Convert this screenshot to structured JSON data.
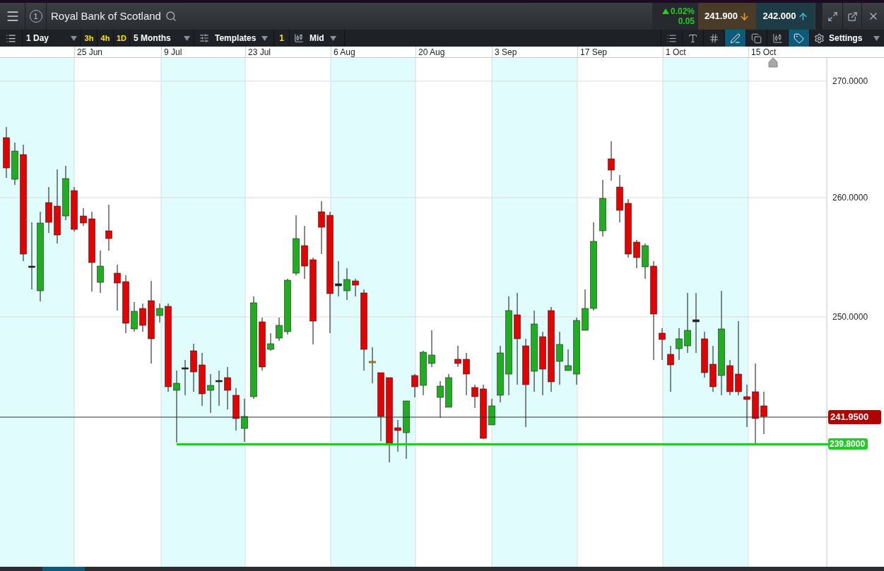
{
  "window": {
    "badge": "1",
    "title": "Royal Bank of Scotland"
  },
  "quote": {
    "change_percent": "0.02%",
    "change": "0.05",
    "sell": "241.900",
    "buy": "242.000"
  },
  "toolbar": {
    "interval": "1 Day",
    "quick_intervals": [
      {
        "label": "3h",
        "selected": false
      },
      {
        "label": "4h",
        "selected": false
      },
      {
        "label": "1D",
        "selected": false
      }
    ],
    "range": "5 Months",
    "templates": "Templates",
    "count": "1",
    "price_type": "Mid",
    "tools": [
      {
        "kind": "axis",
        "selected": false
      },
      {
        "kind": "text",
        "selected": false
      },
      {
        "kind": "grid",
        "selected": false
      },
      {
        "kind": "draw",
        "selected": true
      },
      {
        "kind": "layers",
        "selected": false
      },
      {
        "kind": "candle",
        "selected": false
      },
      {
        "kind": "label",
        "selected": true
      }
    ],
    "settings": "Settings"
  },
  "chart": {
    "dates": [
      "25 Jun",
      "9 Jul",
      "23 Jul",
      "6 Aug",
      "20 Aug",
      "3 Sep",
      "17 Sep",
      "1 Oct",
      "15 Oct"
    ],
    "price_ticks": [
      "270.0000",
      "260.0000",
      "250.0000"
    ],
    "current_price": "241.9500",
    "line_price": "239.8000"
  }
}
